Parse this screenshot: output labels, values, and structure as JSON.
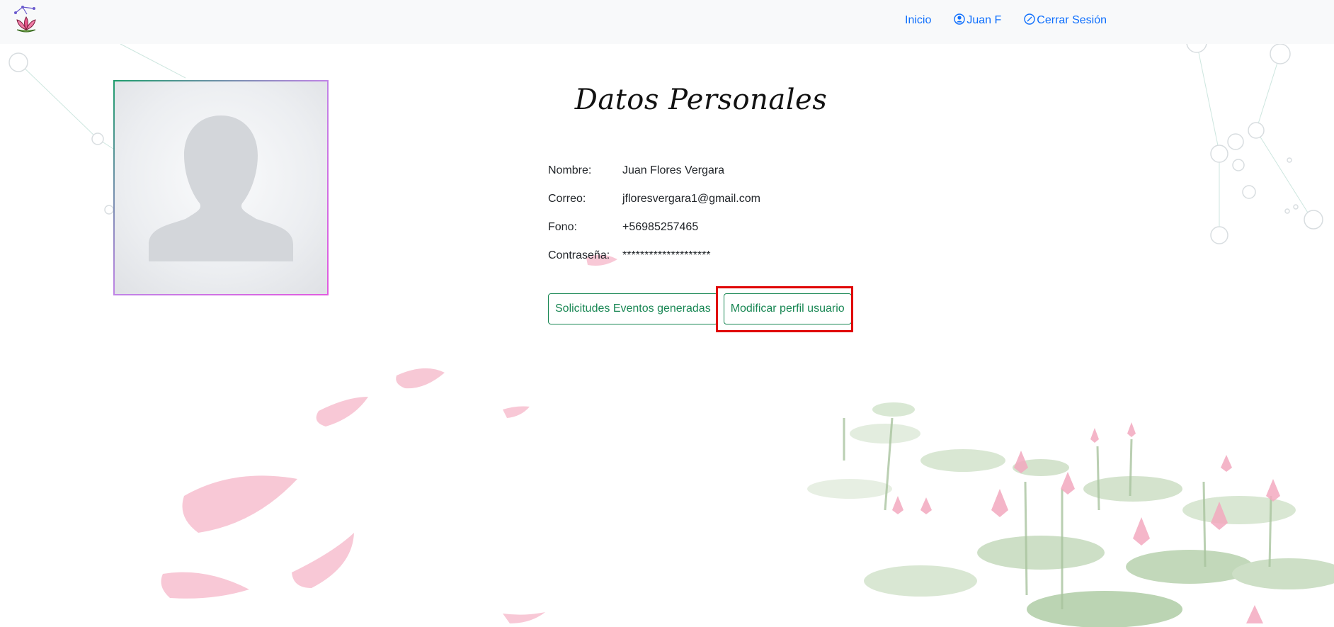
{
  "navbar": {
    "brand_icon": "lotus-logo",
    "links": {
      "home": "Inicio",
      "user": "Juan F",
      "logout": "Cerrar Sesión"
    }
  },
  "profile": {
    "title": "Datos Personales",
    "avatar_icon": "user-placeholder",
    "fields": {
      "name_label": "Nombre:",
      "name_value": "Juan Flores Vergara",
      "email_label": "Correo:",
      "email_value": "jfloresvergara1@gmail.com",
      "phone_label": "Fono:",
      "phone_value": "+56985257465",
      "password_label": "Contraseña:",
      "password_value": "********************"
    },
    "buttons": {
      "requests": "Solicitudes Eventos generadas",
      "modify": "Modificar perfil usuario"
    }
  },
  "colors": {
    "accent": "#198754",
    "link": "#0d6efd",
    "highlight": "#e00000"
  }
}
